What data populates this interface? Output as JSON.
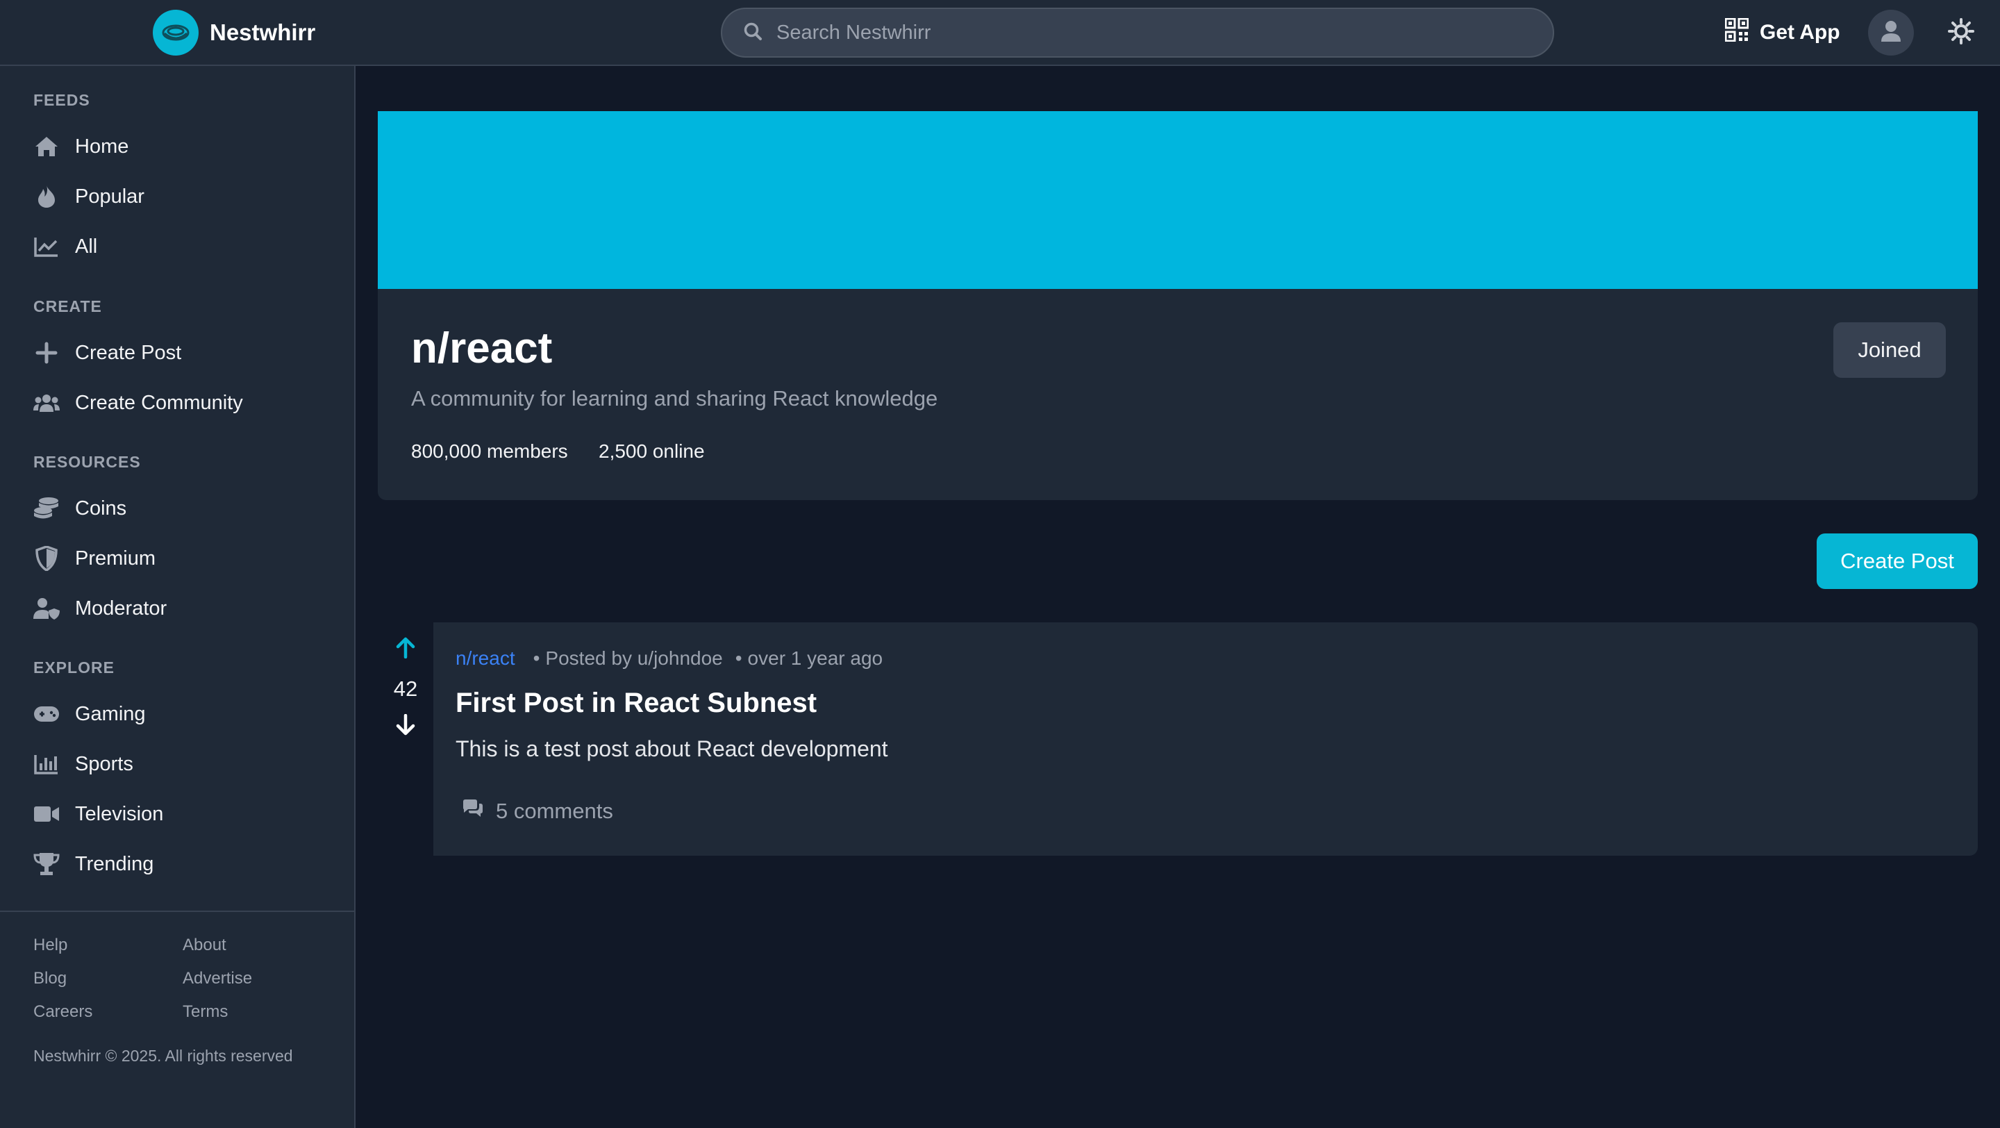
{
  "brand": {
    "name": "Nestwhirr"
  },
  "search": {
    "placeholder": "Search Nestwhirr",
    "value": ""
  },
  "header": {
    "get_app_label": "Get App"
  },
  "sidebar": {
    "sections": [
      {
        "title": "FEEDS",
        "items": [
          {
            "label": "Home",
            "icon": "home-icon"
          },
          {
            "label": "Popular",
            "icon": "flame-icon"
          },
          {
            "label": "All",
            "icon": "chart-line-icon"
          }
        ]
      },
      {
        "title": "CREATE",
        "items": [
          {
            "label": "Create Post",
            "icon": "plus-icon"
          },
          {
            "label": "Create Community",
            "icon": "users-icon"
          }
        ]
      },
      {
        "title": "RESOURCES",
        "items": [
          {
            "label": "Coins",
            "icon": "coins-icon"
          },
          {
            "label": "Premium",
            "icon": "shield-icon"
          },
          {
            "label": "Moderator",
            "icon": "user-shield-icon"
          }
        ]
      },
      {
        "title": "EXPLORE",
        "items": [
          {
            "label": "Gaming",
            "icon": "gamepad-icon"
          },
          {
            "label": "Sports",
            "icon": "bar-chart-icon"
          },
          {
            "label": "Television",
            "icon": "video-icon"
          },
          {
            "label": "Trending",
            "icon": "trophy-icon"
          }
        ]
      }
    ],
    "footer_links": [
      "Help",
      "About",
      "Blog",
      "Advertise",
      "Careers",
      "Terms"
    ],
    "copyright": "Nestwhirr © 2025. All rights reserved"
  },
  "community": {
    "name": "n/react",
    "description": "A community for learning and sharing React knowledge",
    "members": "800,000 members",
    "online": "2,500 online",
    "joined_label": "Joined",
    "banner_color": "#00b6de"
  },
  "actions": {
    "create_post_label": "Create Post"
  },
  "posts": [
    {
      "votes": "42",
      "subnest": "n/react",
      "posted_by": "Posted by u/johndoe",
      "time": "over 1 year ago",
      "title": "First Post in React Subnest",
      "body": "This is a test post about React development",
      "comments": "5 comments"
    }
  ],
  "colors": {
    "accent": "#06b6d4",
    "link": "#3b82f6",
    "background": "#111827",
    "surface": "#1f2937"
  }
}
